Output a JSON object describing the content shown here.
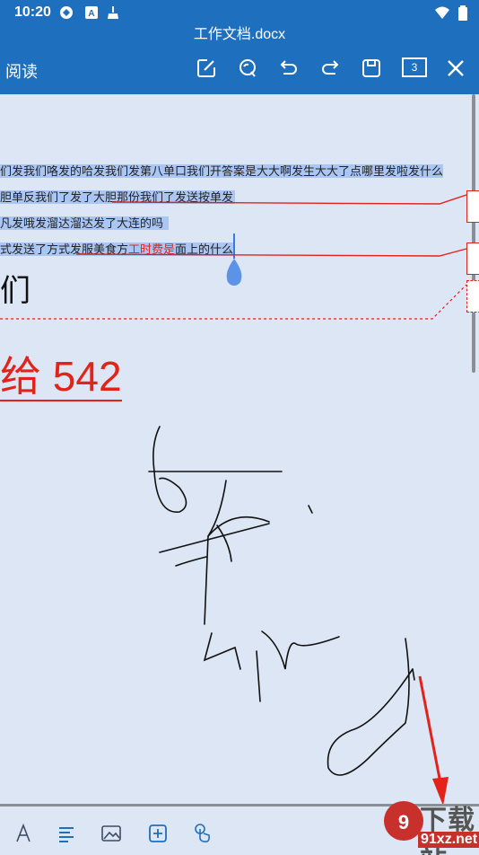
{
  "status_bar": {
    "time": "10:20"
  },
  "title": "工作文档.docx",
  "toolbar": {
    "mode_label": "阅读",
    "page_count": "3"
  },
  "document": {
    "lines": [
      {
        "text": "们发我们咯发的哈发我们发第八单口我们开答案是大大啊发生大大了点哪里发啦发什么"
      },
      {
        "text": "胆单反我们了发了大胆那份我们了发送按单发"
      },
      {
        "text": "凡发哦发溜达溜达发了大连的吗"
      },
      {
        "before": "式发送了方式发服美食方",
        "red": "工时费是",
        "after": "面上的什么"
      }
    ],
    "heading": "们",
    "big_red_text": "给 542"
  },
  "bottom_bar": {
    "items": [
      "text-format-icon",
      "paragraph-icon",
      "image-icon",
      "insert-icon",
      "touch-icon"
    ]
  },
  "watermark": {
    "text1": "下载站",
    "text2": "91xz.net"
  },
  "colors": {
    "accent": "#1f6fbf",
    "selection": "#aac6f4",
    "annotation": "#e2231a",
    "page": "#dde6f4"
  }
}
